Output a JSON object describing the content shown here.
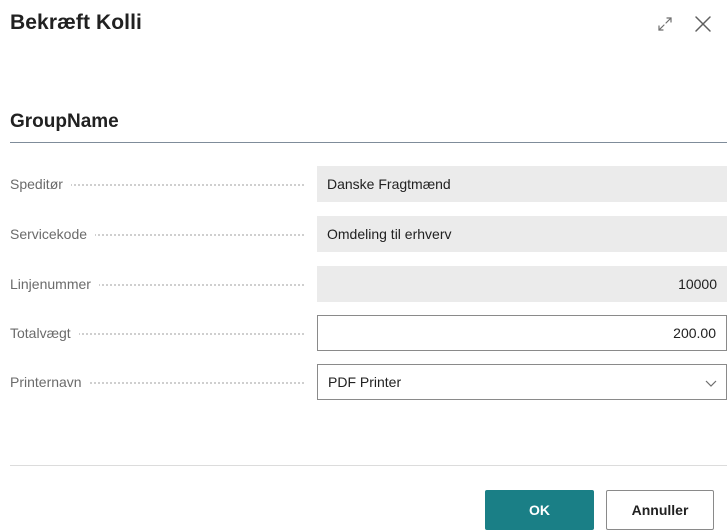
{
  "dialog": {
    "title": "Bekræft Kolli",
    "icons": {
      "expand": "expand-icon",
      "close": "close-icon"
    }
  },
  "group": {
    "name": "GroupName"
  },
  "fields": [
    {
      "label": "Speditør",
      "value": "Danske Fragtmænd",
      "editable": false
    },
    {
      "label": "Servicekode",
      "value": "Omdeling til erhverv",
      "editable": false
    },
    {
      "label": "Linjenummer",
      "value": "10000",
      "editable": false
    },
    {
      "label": "Totalvægt",
      "value": "200.00",
      "editable": true
    },
    {
      "label": "Printernavn",
      "value": "PDF Printer",
      "editable": true
    }
  ],
  "buttons": {
    "ok": "OK",
    "cancel": "Annuller"
  },
  "colors": {
    "primary": "#1a7f86",
    "readonly_bg": "#ebebeb"
  }
}
